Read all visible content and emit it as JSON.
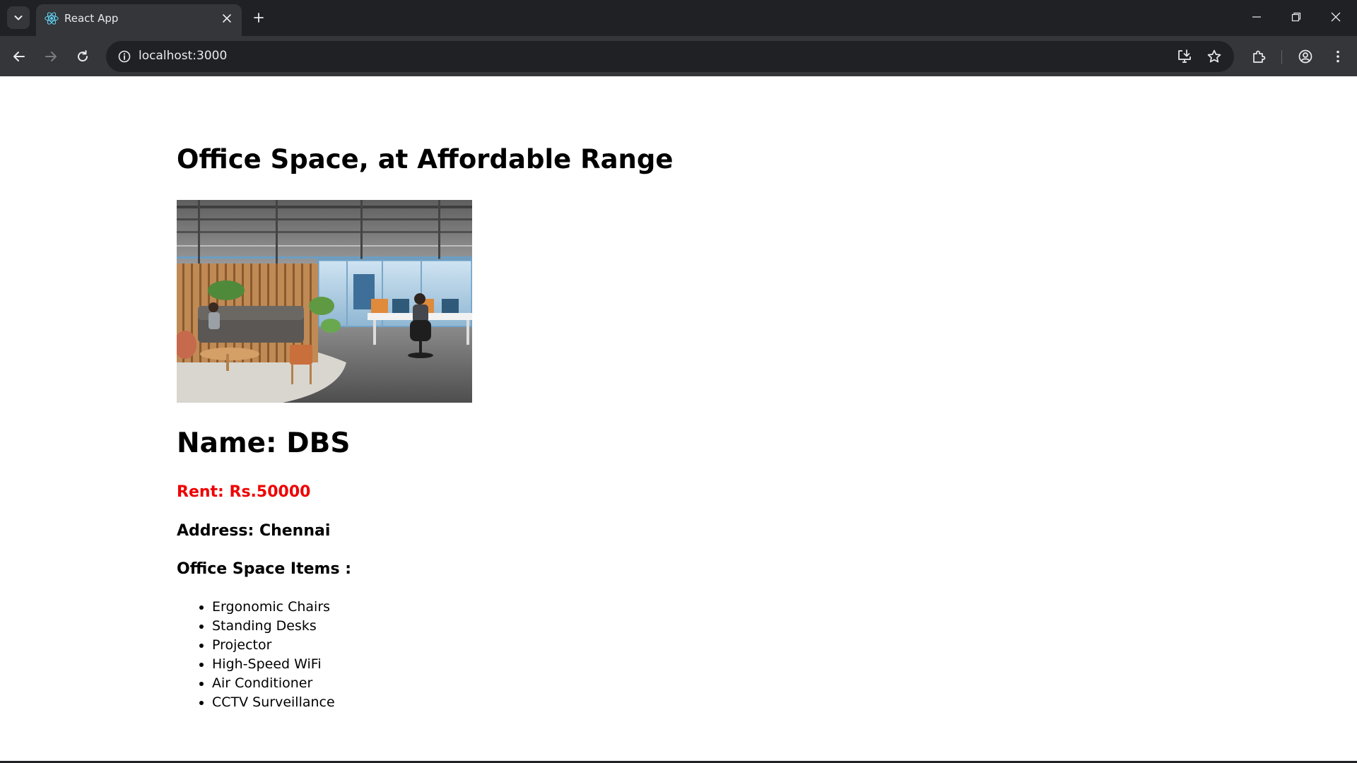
{
  "browser": {
    "tab_title": "React App",
    "url": "localhost:3000"
  },
  "page": {
    "title": "Office Space, at Affordable Range",
    "image_alt": "Office space interior",
    "name": "Name: DBS",
    "rent": "Rent: Rs.50000",
    "address": "Address: Chennai",
    "items_heading": "Office Space Items :",
    "items": [
      "Ergonomic Chairs",
      "Standing Desks",
      "Projector",
      "High-Speed WiFi",
      "Air Conditioner",
      "CCTV Surveillance"
    ]
  },
  "colors": {
    "rent": "#ee0000",
    "chrome_dark": "#202124",
    "chrome_toolbar": "#35363a"
  },
  "icons": {
    "tab_favicon": "react-logo-icon",
    "tab_search": "chevron-down-icon",
    "tab_close": "close-icon",
    "new_tab": "plus-icon",
    "back": "arrow-left-icon",
    "forward": "arrow-right-icon",
    "reload": "reload-icon",
    "site_info": "info-icon",
    "install_app": "install-app-icon",
    "bookmark": "star-icon",
    "extensions": "puzzle-icon",
    "profile": "profile-icon",
    "menu": "kebab-menu-icon"
  }
}
